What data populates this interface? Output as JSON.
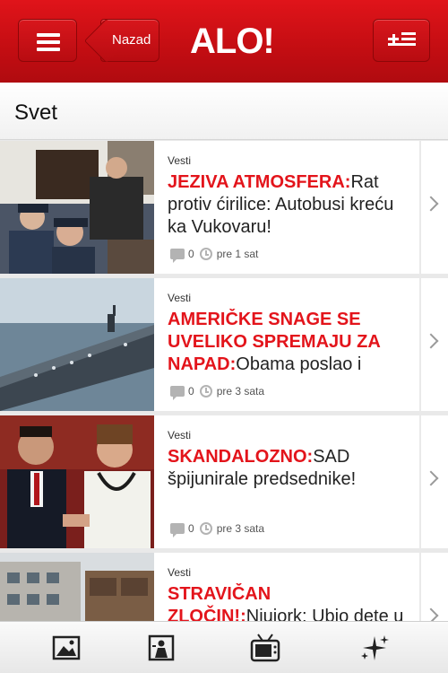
{
  "header": {
    "back_label": "Nazad",
    "logo_text": "ALO!",
    "brand_color": "#d01016"
  },
  "section": {
    "title": "Svet"
  },
  "articles": [
    {
      "category": "Vesti",
      "headline_red": "JEZIVA ATMOSFERA:",
      "headline": "Rat protiv ćirilice: Autobusi kreću ka Vukovaru!",
      "comments": "0",
      "time": "pre 1 sat"
    },
    {
      "category": "Vesti",
      "headline_red": "AMERIČKE SNAGE SE UVELIKO SPREMAJU ZA NAPAD:",
      "headline": "Obama poslao i",
      "comments": "0",
      "time": "pre 3 sata"
    },
    {
      "category": "Vesti",
      "headline_red": "SKANDALOZNO:",
      "headline": "SAD špijunirale predsednike!",
      "comments": "0",
      "time": "pre 3 sata"
    },
    {
      "category": "Vesti",
      "headline_red": "STRAVIČAN ZLOČIN!:",
      "headline": "Njujork: Ubio dete u",
      "comments": "",
      "time": ""
    }
  ],
  "toolbar": {
    "icons": [
      "gallery-icon",
      "photo-person-icon",
      "tv-icon",
      "stars-icon"
    ]
  }
}
